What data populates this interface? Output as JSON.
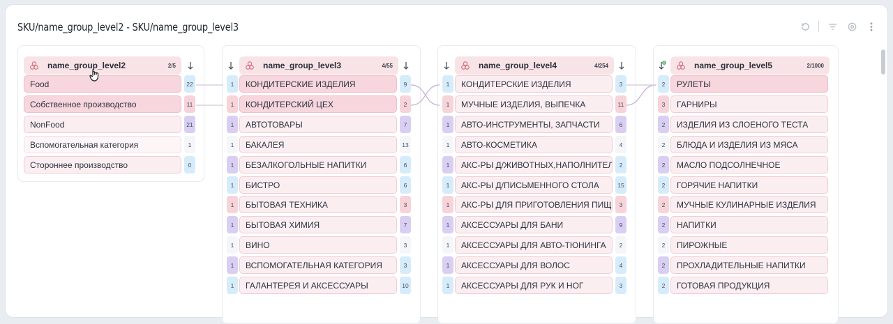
{
  "title": "SKU/name_group_level2 - SKU/name_group_level3",
  "toolbar": {
    "icons": [
      "refresh-icon",
      "filter-icon",
      "settings-icon",
      "more-vertical-icon"
    ]
  },
  "colors": {
    "row_bg": "#fbeef1",
    "row_selected_bg": "#f7d6dd",
    "badge_blue": "#d6ecfa",
    "badge_pink": "#f7d3da",
    "badge_purple": "#d9cff3",
    "connector": "#d6b8d5"
  },
  "panels": [
    {
      "header": {
        "name": "name_group_level2",
        "count": "2/5"
      },
      "rows": [
        {
          "label": "Food",
          "count": "22",
          "badge": "blue",
          "state": "hi"
        },
        {
          "label": "Собственное производство",
          "count": "11",
          "badge": "pink",
          "state": "hi"
        },
        {
          "label": "NonFood",
          "count": "21",
          "badge": "purple",
          "state": ""
        },
        {
          "label": "Вспомогательная категория",
          "count": "1",
          "badge": "white",
          "state": "light"
        },
        {
          "label": "Стороннее производство",
          "count": "0",
          "badge": "blue",
          "state": ""
        }
      ]
    },
    {
      "header": {
        "name": "name_group_level3",
        "count": "4/55"
      },
      "rows": [
        {
          "left": "1",
          "leftBadge": "blue",
          "label": "КОНДИТЕРСКИЕ ИЗДЕЛИЯ",
          "count": "9",
          "badge": "blue",
          "state": "hi"
        },
        {
          "left": "1",
          "leftBadge": "pink",
          "label": "КОНДИТЕРСКИЙ ЦЕХ",
          "count": "2",
          "badge": "pink",
          "state": "hi"
        },
        {
          "left": "1",
          "leftBadge": "purple",
          "label": "АВТОТОВАРЫ",
          "count": "7",
          "badge": "purple",
          "state": ""
        },
        {
          "left": "1",
          "leftBadge": "white",
          "label": "БАКАЛЕЯ",
          "count": "13",
          "badge": "white",
          "state": ""
        },
        {
          "left": "1",
          "leftBadge": "purple",
          "label": "БЕЗАЛКОГОЛЬНЫЕ НАПИТКИ",
          "count": "6",
          "badge": "blue",
          "state": ""
        },
        {
          "left": "1",
          "leftBadge": "blue",
          "label": "БИСТРО",
          "count": "6",
          "badge": "blue",
          "state": ""
        },
        {
          "left": "1",
          "leftBadge": "pink",
          "label": "БЫТОВАЯ ТЕХНИКА",
          "count": "3",
          "badge": "pink",
          "state": ""
        },
        {
          "left": "1",
          "leftBadge": "purple",
          "label": "БЫТОВАЯ ХИМИЯ",
          "count": "7",
          "badge": "purple",
          "state": ""
        },
        {
          "left": "1",
          "leftBadge": "white",
          "label": "ВИНО",
          "count": "3",
          "badge": "white",
          "state": ""
        },
        {
          "left": "1",
          "leftBadge": "purple",
          "label": "ВСПОМОГАТЕЛЬНАЯ КАТЕГОРИЯ",
          "count": "3",
          "badge": "blue",
          "state": ""
        },
        {
          "left": "1",
          "leftBadge": "blue",
          "label": "ГАЛАНТЕРЕЯ И АКСЕССУАРЫ",
          "count": "10",
          "badge": "blue",
          "state": ""
        }
      ]
    },
    {
      "header": {
        "name": "name_group_level4",
        "count": "4/254"
      },
      "rows": [
        {
          "left": "1",
          "leftBadge": "blue",
          "label": "КОНДИТЕРСКИЕ ИЗДЕЛИЯ",
          "count": "3",
          "badge": "blue",
          "state": ""
        },
        {
          "left": "1",
          "leftBadge": "pink",
          "label": "МУЧНЫЕ ИЗДЕЛИЯ, ВЫПЕЧКА",
          "count": "11",
          "badge": "pink",
          "state": ""
        },
        {
          "left": "1",
          "leftBadge": "purple",
          "label": "АВТО-ИНСТРУМЕНТЫ, ЗАПЧАСТИ",
          "count": "6",
          "badge": "purple",
          "state": ""
        },
        {
          "left": "1",
          "leftBadge": "white",
          "label": "АВТО-КОСМЕТИКА",
          "count": "4",
          "badge": "white",
          "state": ""
        },
        {
          "left": "1",
          "leftBadge": "purple",
          "label": "АКС-РЫ Д/ЖИВОТНЫХ,НАПОЛНИТЕЛ",
          "count": "2",
          "badge": "blue",
          "state": ""
        },
        {
          "left": "1",
          "leftBadge": "blue",
          "label": "АКС-РЫ Д/ПИСЬМЕННОГО СТОЛА",
          "count": "15",
          "badge": "blue",
          "state": ""
        },
        {
          "left": "1",
          "leftBadge": "pink",
          "label": "АКС-РЫ ДЛЯ ПРИГОТОВЛЕНИЯ ПИЩ",
          "count": "3",
          "badge": "pink",
          "state": ""
        },
        {
          "left": "1",
          "leftBadge": "purple",
          "label": "АКСЕССУАРЫ ДЛЯ БАНИ",
          "count": "9",
          "badge": "purple",
          "state": ""
        },
        {
          "left": "1",
          "leftBadge": "white",
          "label": "АКСЕССУАРЫ ДЛЯ АВТО-ТЮНИНГА",
          "count": "2",
          "badge": "white",
          "state": ""
        },
        {
          "left": "1",
          "leftBadge": "purple",
          "label": "АКСЕССУАРЫ ДЛЯ ВОЛОС",
          "count": "4",
          "badge": "blue",
          "state": ""
        },
        {
          "left": "1",
          "leftBadge": "blue",
          "label": "АКСЕССУАРЫ ДЛЯ РУК И НОГ",
          "count": "3",
          "badge": "blue",
          "state": ""
        }
      ]
    },
    {
      "header": {
        "name": "name_group_level5",
        "count": "2/1000"
      },
      "rows": [
        {
          "left": "2",
          "leftBadge": "blue",
          "label": "РУЛЕТЫ",
          "state": "hi"
        },
        {
          "left": "3",
          "leftBadge": "pink",
          "label": "ГАРНИРЫ",
          "state": ""
        },
        {
          "left": "2",
          "leftBadge": "purple",
          "label": "ИЗДЕЛИЯ ИЗ СЛОЕНОГО ТЕСТА",
          "state": ""
        },
        {
          "left": "2",
          "leftBadge": "white",
          "label": "БЛЮДА И ИЗДЕЛИЯ ИЗ МЯСА",
          "state": ""
        },
        {
          "left": "2",
          "leftBadge": "purple",
          "label": "МАСЛО ПОДСОЛНЕЧНОЕ",
          "state": ""
        },
        {
          "left": "2",
          "leftBadge": "blue",
          "label": "ГОРЯЧИЕ НАПИТКИ",
          "state": ""
        },
        {
          "left": "2",
          "leftBadge": "pink",
          "label": "МУЧНЫЕ КУЛИНАРНЫЕ ИЗДЕЛИЯ",
          "state": ""
        },
        {
          "left": "2",
          "leftBadge": "purple",
          "label": "НАПИТКИ",
          "state": ""
        },
        {
          "left": "2",
          "leftBadge": "white",
          "label": "ПИРОЖНЫЕ",
          "state": ""
        },
        {
          "left": "2",
          "leftBadge": "purple",
          "label": "ПРОХЛАДИТЕЛЬНЫЕ НАПИТКИ",
          "state": ""
        },
        {
          "left": "2",
          "leftBadge": "blue",
          "label": "ГОТОВАЯ ПРОДУКЦИЯ",
          "state": ""
        }
      ]
    }
  ]
}
